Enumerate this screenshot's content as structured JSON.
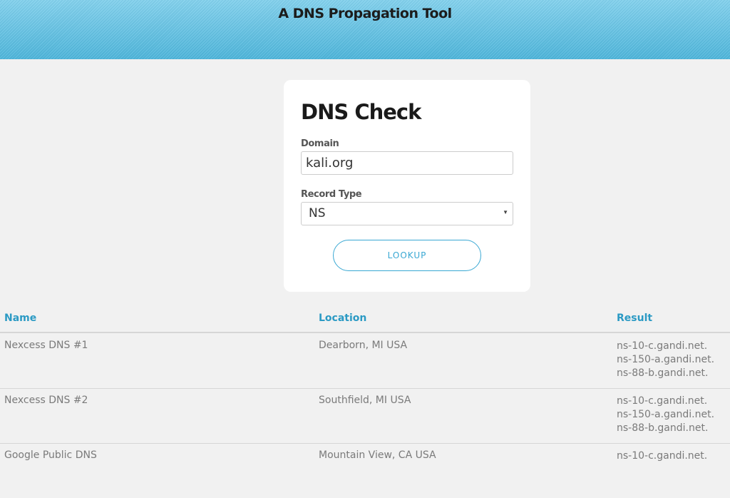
{
  "header": {
    "title": "A DNS Propagation Tool"
  },
  "form": {
    "title": "DNS Check",
    "domain_label": "Domain",
    "domain_value": "kali.org",
    "record_type_label": "Record Type",
    "record_type_value": "NS",
    "lookup_label": "LOOKUP"
  },
  "table": {
    "headers": {
      "name": "Name",
      "location": "Location",
      "result": "Result"
    },
    "rows": [
      {
        "name": "Nexcess DNS #1",
        "location": "Dearborn, MI USA",
        "results": [
          "ns-10-c.gandi.net.",
          "ns-150-a.gandi.net.",
          "ns-88-b.gandi.net."
        ]
      },
      {
        "name": "Nexcess DNS #2",
        "location": "Southfield, MI USA",
        "results": [
          "ns-10-c.gandi.net.",
          "ns-150-a.gandi.net.",
          "ns-88-b.gandi.net."
        ]
      },
      {
        "name": "Google Public DNS",
        "location": "Mountain View, CA USA",
        "results": [
          "ns-10-c.gandi.net."
        ]
      }
    ]
  },
  "colors": {
    "header_bg": "#5fc4e6",
    "accent": "#2b9ac4",
    "button_border": "#3aa8d3"
  }
}
